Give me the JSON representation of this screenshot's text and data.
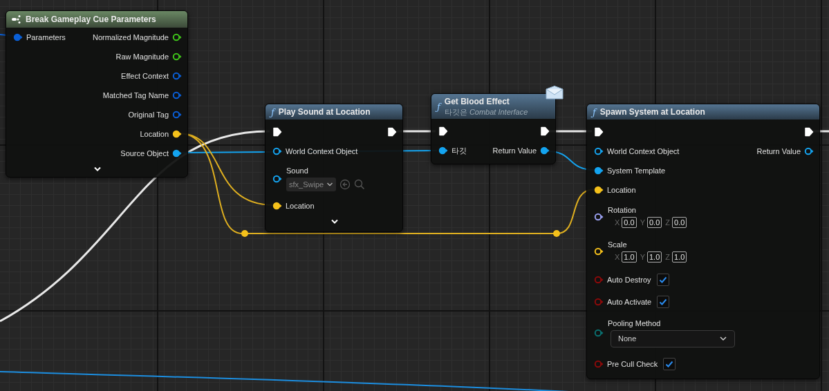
{
  "nodes": [
    {
      "kind": "break",
      "title": "Break Gameplay Cue Parameters",
      "expander": true,
      "rows": [
        {
          "kind": "pins",
          "in": {
            "label": "Parameters",
            "color": "#0a5fd6",
            "connected": true
          },
          "out": {
            "label": "Normalized Magnitude",
            "color": "#3fc41a",
            "connected": false
          }
        },
        {
          "kind": "pins",
          "out": {
            "label": "Raw Magnitude",
            "color": "#3fc41a",
            "connected": false
          }
        },
        {
          "kind": "pins",
          "out": {
            "label": "Effect Context",
            "color": "#0a5fd6",
            "connected": false
          }
        },
        {
          "kind": "pins",
          "out": {
            "label": "Matched Tag Name",
            "color": "#0a5fd6",
            "connected": false
          }
        },
        {
          "kind": "pins",
          "out": {
            "label": "Original Tag",
            "color": "#0a5fd6",
            "connected": false
          }
        },
        {
          "kind": "pins",
          "out": {
            "label": "Location",
            "color": "#f5c11b",
            "connected": true
          }
        },
        {
          "kind": "pins",
          "out": {
            "label": "Source Object",
            "color": "#14a4f0",
            "connected": true
          }
        }
      ]
    },
    {
      "kind": "function",
      "icon": "ƒ",
      "title": "Play Sound at Location",
      "expander": true,
      "rows": [
        {
          "kind": "exec",
          "in": {
            "connected": true
          },
          "out": {
            "connected": true
          }
        },
        {
          "kind": "pins",
          "in": {
            "label": "World Context Object",
            "color": "#14a4f0",
            "connected": false
          }
        },
        {
          "kind": "asset",
          "in": {
            "label": "Sound",
            "color": "#14a4f0",
            "connected": false
          },
          "value": "sfx_Swipe"
        },
        {
          "kind": "pins",
          "in": {
            "label": "Location",
            "color": "#f5c11b",
            "connected": true
          }
        }
      ]
    },
    {
      "kind": "function",
      "icon": "ƒ",
      "title": "Get Blood Effect",
      "subtitle": "타깃은 *Combat Interface*",
      "message": true,
      "rows": [
        {
          "kind": "exec",
          "in": {
            "connected": true
          },
          "out": {
            "connected": true
          }
        },
        {
          "kind": "pins",
          "in": {
            "label": "타깃",
            "color": "#14a4f0",
            "connected": true
          },
          "out": {
            "label": "Return Value",
            "color": "#14a4f0",
            "connected": true
          }
        }
      ]
    },
    {
      "kind": "function",
      "icon": "ƒ",
      "title": "Spawn System at Location",
      "rows": [
        {
          "kind": "exec",
          "in": {
            "connected": true
          },
          "out": {
            "connected": true
          }
        },
        {
          "kind": "pins",
          "in": {
            "label": "World Context Object",
            "color": "#14a4f0",
            "connected": false
          },
          "out": {
            "label": "Return Value",
            "color": "#14a4f0",
            "connected": false
          }
        },
        {
          "kind": "pins",
          "in": {
            "label": "System Template",
            "color": "#14a4f0",
            "connected": true
          }
        },
        {
          "kind": "pins",
          "in": {
            "label": "Location",
            "color": "#f5c11b",
            "connected": true
          }
        },
        {
          "kind": "vector",
          "in": {
            "label": "Rotation",
            "color": "#9aa0f0",
            "connected": false
          },
          "fields": [
            {
              "axis": "X",
              "value": "0.0"
            },
            {
              "axis": "Y",
              "value": "0.0"
            },
            {
              "axis": "Z",
              "value": "0.0"
            }
          ]
        },
        {
          "kind": "vector",
          "in": {
            "label": "Scale",
            "color": "#f5c11b",
            "connected": false
          },
          "fields": [
            {
              "axis": "X",
              "value": "1.0"
            },
            {
              "axis": "Y",
              "value": "1.0"
            },
            {
              "axis": "Z",
              "value": "1.0"
            }
          ]
        },
        {
          "kind": "bool",
          "in": {
            "label": "Auto Destroy",
            "color": "#8c0a0a",
            "connected": false
          },
          "checked": true
        },
        {
          "kind": "bool",
          "in": {
            "label": "Auto Activate",
            "color": "#8c0a0a",
            "connected": false
          },
          "checked": true
        },
        {
          "kind": "enum",
          "in": {
            "label": "Pooling Method",
            "color": "#0a7070",
            "connected": false
          },
          "value": "None"
        },
        {
          "kind": "bool",
          "in": {
            "label": "Pre Cull Check",
            "color": "#8c0a0a",
            "connected": false
          },
          "checked": true
        }
      ]
    }
  ]
}
